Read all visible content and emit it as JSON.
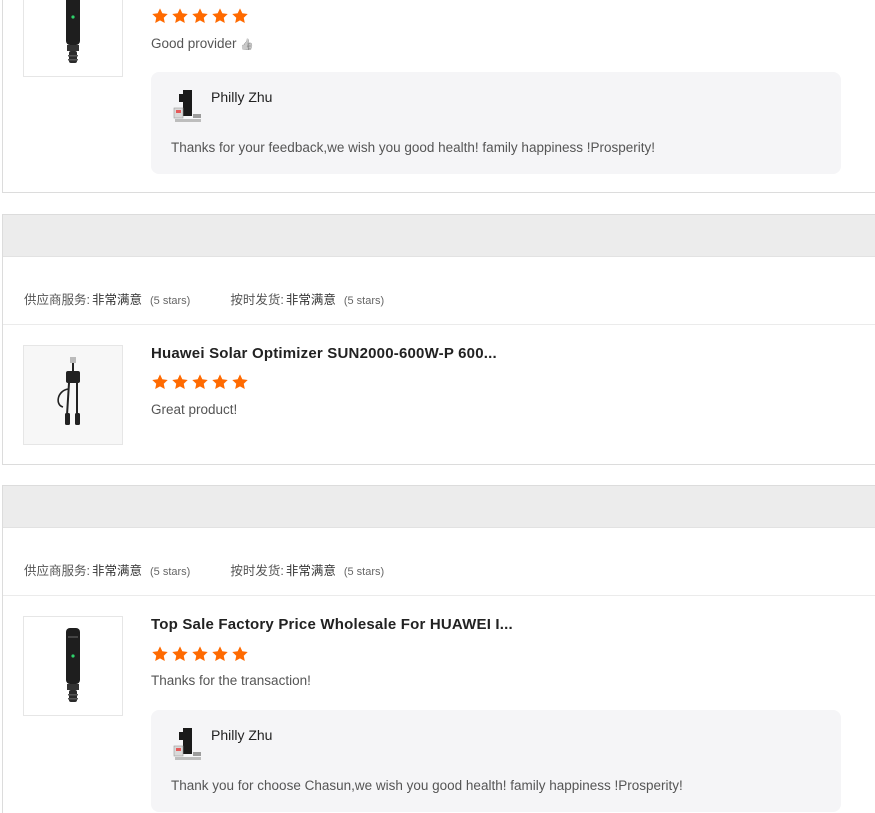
{
  "ratings_labels": {
    "supplier_service": "供应商服务:",
    "on_time_shipment": "按时发货:",
    "value": "非常满意",
    "count": "(5 stars)"
  },
  "review1": {
    "comment": "Good provider",
    "comment_emoji": "👍",
    "stars": 5,
    "reply": {
      "name": "Philly Zhu",
      "text": "Thanks for your feedback,we wish you good health! family happiness !Prosperity!"
    }
  },
  "review2": {
    "title": "Huawei Solar Optimizer SUN2000-600W-P 600...",
    "stars": 5,
    "comment": "Great product!"
  },
  "review3": {
    "title": "Top Sale Factory Price Wholesale For HUAWEI I...",
    "stars": 5,
    "comment": "Thanks for the transaction!",
    "reply": {
      "name": "Philly Zhu",
      "text": "Thank you for choose Chasun,we wish you good health! family happiness !Prosperity!"
    }
  },
  "colors": {
    "star": "#ff6a00",
    "reply_bg": "#f5f5f7",
    "header_bg": "#ececec"
  },
  "icons": {
    "star": "star-icon",
    "thumbs_up": "thumbs-up-icon",
    "product": "solar-optimizer-image",
    "avatar": "supplier-avatar"
  }
}
